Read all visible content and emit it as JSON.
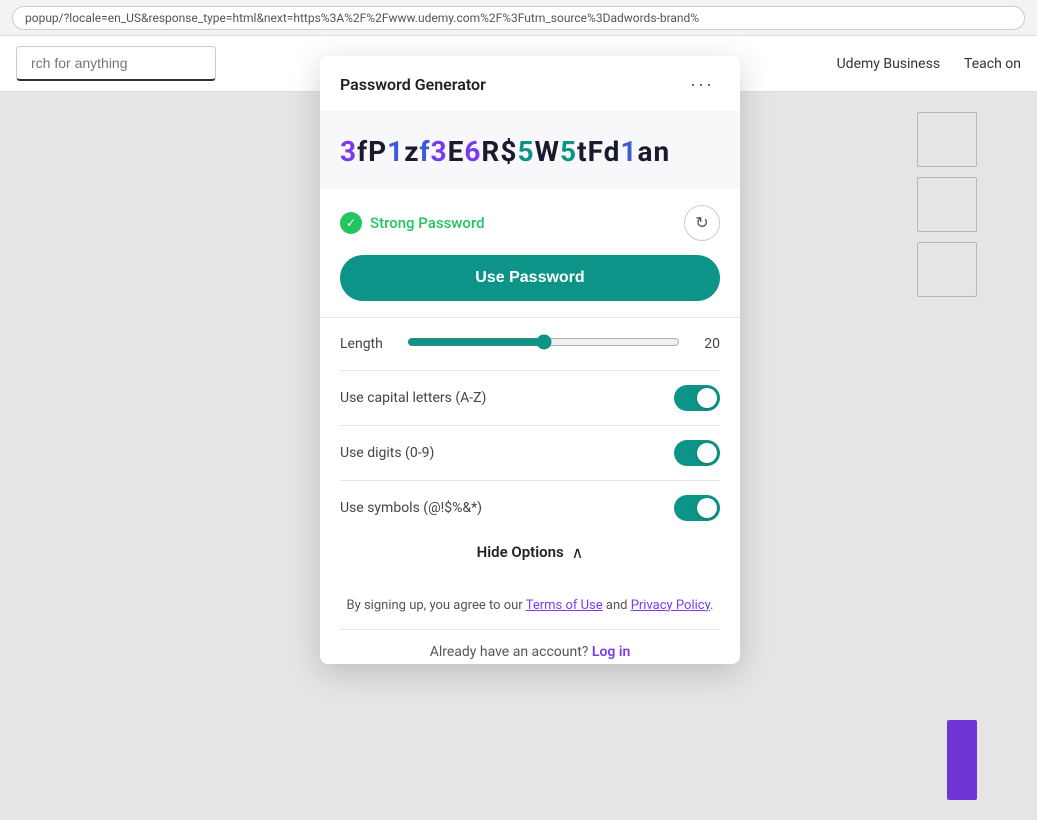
{
  "browser": {
    "address": "popup/?locale=en_US&response_type=html&next=https%3A%2F%2Fwww.udemy.com%2F%3Futm_source%3Dadwords-brand%"
  },
  "header": {
    "search_placeholder": "rch for anything",
    "udemy_business_label": "Udemy Business",
    "teach_on_label": "Teach on"
  },
  "popup": {
    "title": "Password Generator",
    "menu_icon": "···",
    "password": {
      "text": "3fP1zf3E6R$5W5tFd1an",
      "chars": [
        {
          "char": "3",
          "type": "purple"
        },
        {
          "char": "f",
          "type": "default"
        },
        {
          "char": "P",
          "type": "default"
        },
        {
          "char": "1",
          "type": "blue"
        },
        {
          "char": "z",
          "type": "default"
        },
        {
          "char": "f",
          "type": "blue"
        },
        {
          "char": "3",
          "type": "purple"
        },
        {
          "char": "E",
          "type": "default"
        },
        {
          "char": "6",
          "type": "purple"
        },
        {
          "char": "R",
          "type": "default"
        },
        {
          "char": "$",
          "type": "default"
        },
        {
          "char": "5",
          "type": "teal"
        },
        {
          "char": "W",
          "type": "default"
        },
        {
          "char": "5",
          "type": "teal"
        },
        {
          "char": "t",
          "type": "default"
        },
        {
          "char": "F",
          "type": "default"
        },
        {
          "char": "d",
          "type": "default"
        },
        {
          "char": "1",
          "type": "blue"
        },
        {
          "char": "a",
          "type": "default"
        },
        {
          "char": "n",
          "type": "default"
        }
      ]
    },
    "strong_label": "Strong Password",
    "refresh_icon": "↻",
    "use_password_label": "Use Password",
    "length_label": "Length",
    "length_value": "20",
    "options": [
      {
        "label": "Use capital letters (A-Z)",
        "enabled": true
      },
      {
        "label": "Use digits (0-9)",
        "enabled": true
      },
      {
        "label": "Use symbols (@!$%&*)",
        "enabled": true
      }
    ],
    "hide_options_label": "Hide Options",
    "terms_text_before": "By signing up, you agree to our ",
    "terms_of_use": "Terms of Use",
    "terms_and": " and ",
    "privacy_policy": "Privacy Policy",
    "terms_text_after": ".",
    "login_text": "Already have an account?",
    "login_link": "Log in"
  },
  "colors": {
    "teal": "#0d9488",
    "purple": "#7c3aed",
    "blue": "#3b5bdb",
    "green": "#22c55e"
  }
}
